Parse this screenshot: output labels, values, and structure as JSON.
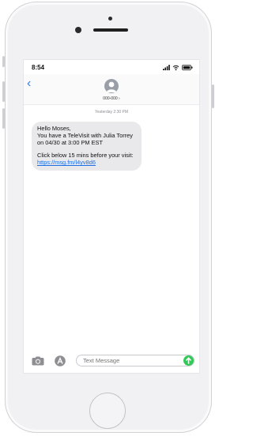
{
  "status_bar": {
    "time": "8:54"
  },
  "header": {
    "contact": "000-000 ›",
    "back_label": "‹"
  },
  "thread": {
    "date_label": "Yesterday 2:30 PM",
    "message": {
      "line1": "Hello Moses,",
      "line2": "You have a TeleVisit with Julia Torrey on 04/30 at 3:00 PM EST",
      "line3": "Click below 15 mins before your visit:",
      "link": "https://msg.fm/l4yv8d6"
    }
  },
  "composer": {
    "placeholder": "Text Message"
  },
  "colors": {
    "accent": "#2f7cf6",
    "send": "#34c759",
    "bubble": "#e9e9eb"
  },
  "icons": [
    "back-chevron-icon",
    "contact-avatar-icon",
    "camera-icon",
    "app-store-icon",
    "send-arrow-icon",
    "signal-icon",
    "wifi-icon",
    "battery-icon"
  ]
}
